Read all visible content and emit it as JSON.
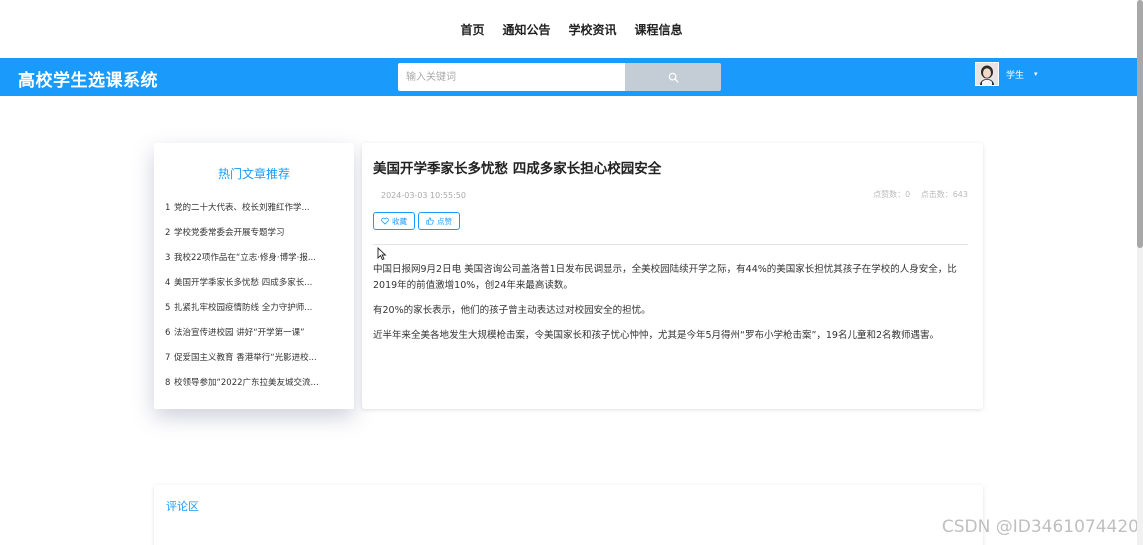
{
  "nav": {
    "items": [
      "首页",
      "通知公告",
      "学校资讯",
      "课程信息"
    ]
  },
  "header": {
    "brand": "高校学生选课系统",
    "search_placeholder": "输入关键词",
    "search_icon": "search-icon",
    "user_name": "学生",
    "user_caret": "▾"
  },
  "hot": {
    "title": "热门文章推荐",
    "items": [
      {
        "num": "1",
        "text": "党的二十大代表、校长刘雅红作学..."
      },
      {
        "num": "2",
        "text": "学校党委常委会开展专题学习"
      },
      {
        "num": "3",
        "text": "我校22项作品在“立志·修身·博学·报..."
      },
      {
        "num": "4",
        "text": "美国开学季家长多忧愁 四成多家长..."
      },
      {
        "num": "5",
        "text": "扎紧扎牢校园疫情防线 全力守护师..."
      },
      {
        "num": "6",
        "text": "法治宣传进校园 讲好“开学第一课”"
      },
      {
        "num": "7",
        "text": "促爱国主义教育 香港举行“光影进校..."
      },
      {
        "num": "8",
        "text": "校领导参加“2022广东拉美友城交流..."
      }
    ]
  },
  "article": {
    "title": "美国开学季家长多忧愁 四成多家长担心校园安全",
    "date": "2024-03-03 10:55:50",
    "likes": "点赞数：0",
    "clicks": "点击数：643",
    "favorite_label": "收藏",
    "like_label": "点赞",
    "paragraphs": [
      "中国日报网9月2日电 美国咨询公司盖洛普1日发布民调显示，全美校园陆续开学之际，有44%的美国家长担忧其孩子在学校的人身安全，比2019年的前值激增10%，创24年来最高读数。",
      "有20%的家长表示，他们的孩子曾主动表达过对校园安全的担忧。",
      "近半年来全美各地发生大规模枪击案，令美国家长和孩子忧心忡忡，尤其是今年5月得州“罗布小学枪击案”，19名儿童和2名教师遇害。"
    ]
  },
  "comments": {
    "title": "评论区"
  },
  "watermark": "CSDN @ID3461074420",
  "colors": {
    "accent": "#1a9bfc",
    "search_button": "#c4ccd6"
  }
}
